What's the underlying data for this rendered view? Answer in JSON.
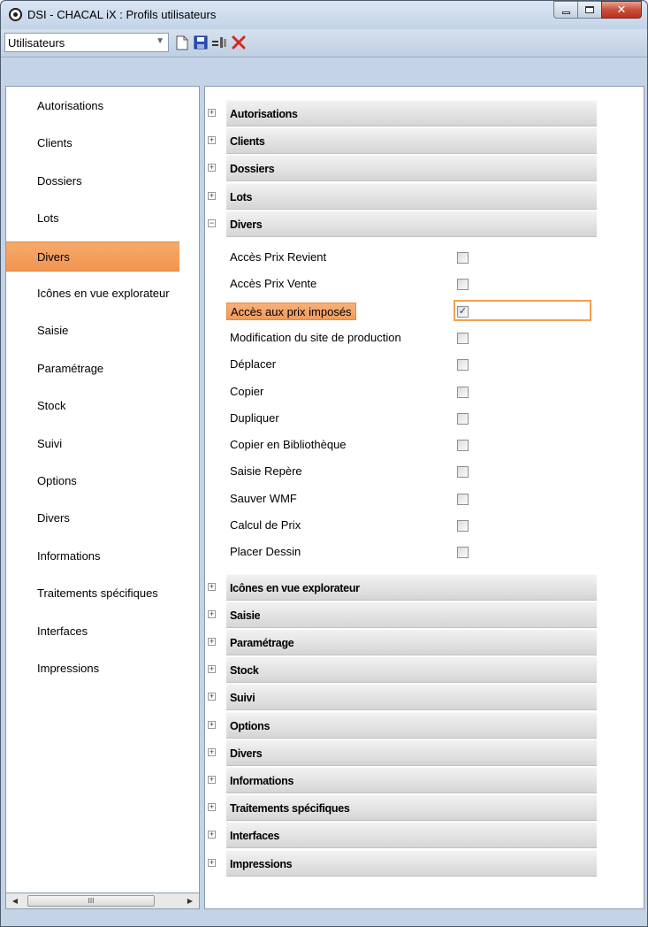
{
  "window": {
    "title": "DSI - CHACAL iX : Profils utilisateurs"
  },
  "toolbar": {
    "combo_value": "Utilisateurs"
  },
  "sidebar": {
    "selected_index": 4,
    "items": [
      "Autorisations",
      "Clients",
      "Dossiers",
      "Lots",
      "Divers",
      "Icônes en vue explorateur",
      "Saisie",
      "Paramétrage",
      "Stock",
      "Suivi",
      "Options",
      "Divers",
      "Informations",
      "Traitements spécifiques",
      "Interfaces",
      "Impressions"
    ]
  },
  "groups_before": [
    {
      "label": "Autorisations",
      "expanded": false
    },
    {
      "label": "Clients",
      "expanded": false
    },
    {
      "label": "Dossiers",
      "expanded": false
    },
    {
      "label": "Lots",
      "expanded": false
    },
    {
      "label": "Divers",
      "expanded": true
    }
  ],
  "divers_options": [
    {
      "label": "Accès Prix Revient",
      "checked": false
    },
    {
      "label": "Accès Prix Vente",
      "checked": false
    },
    {
      "label": "Accès aux prix imposés",
      "checked": true,
      "selected": true
    },
    {
      "label": "Modification du site de production",
      "checked": false
    },
    {
      "label": "Déplacer",
      "checked": false
    },
    {
      "label": "Copier",
      "checked": false
    },
    {
      "label": "Dupliquer",
      "checked": false
    },
    {
      "label": "Copier en Bibliothèque",
      "checked": false
    },
    {
      "label": "Saisie Repère",
      "checked": false
    },
    {
      "label": "Sauver WMF",
      "checked": false
    },
    {
      "label": "Calcul de Prix",
      "checked": false
    },
    {
      "label": "Placer Dessin",
      "checked": false
    }
  ],
  "groups_after": [
    {
      "label": "Icônes en vue explorateur",
      "expanded": false
    },
    {
      "label": "Saisie",
      "expanded": false
    },
    {
      "label": "Paramétrage",
      "expanded": false
    },
    {
      "label": "Stock",
      "expanded": false
    },
    {
      "label": "Suivi",
      "expanded": false
    },
    {
      "label": "Options",
      "expanded": false
    },
    {
      "label": "Divers",
      "expanded": false
    },
    {
      "label": "Informations",
      "expanded": false
    },
    {
      "label": "Traitements spécifiques",
      "expanded": false
    },
    {
      "label": "Interfaces",
      "expanded": false
    },
    {
      "label": "Impressions",
      "expanded": false
    }
  ],
  "hscroll": {
    "thumb_grip": "III",
    "left_arrow": "◀",
    "right_arrow": "▶"
  },
  "colors": {
    "selection": "#f39a58",
    "focus_border": "#f5a04e",
    "check": "#1b3f8f"
  }
}
